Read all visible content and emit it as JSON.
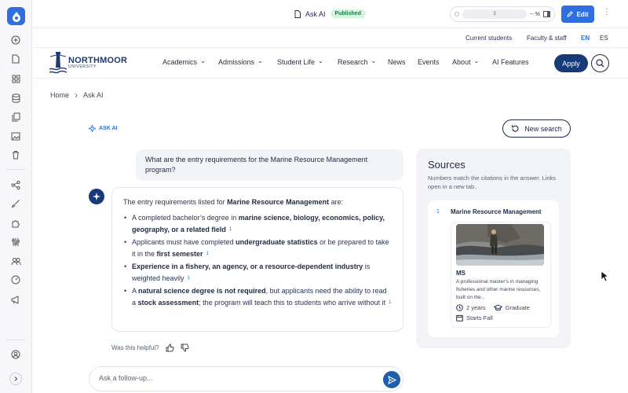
{
  "toolbar": {
    "doc_title": "Ask AI",
    "status_badge": "Published",
    "zoom_value": "3",
    "zoom_pct": "-- %",
    "edit_label": "Edit",
    "more_label": "⋮"
  },
  "utility": {
    "current_students": "Current students",
    "faculty_staff": "Faculty & staff",
    "lang_en": "EN",
    "lang_es": "ES"
  },
  "brand": {
    "name": "NORTHMOOR",
    "sub": "UNIVERSITY"
  },
  "nav": {
    "items": [
      {
        "label": "Academics",
        "dropdown": "⌄"
      },
      {
        "label": "Admissions",
        "dropdown": "⌄"
      },
      {
        "label": "Student Life",
        "dropdown": "⌄"
      },
      {
        "label": "Research",
        "dropdown": "⌄"
      },
      {
        "label": "News"
      },
      {
        "label": "Events"
      },
      {
        "label": "About",
        "dropdown": "⌄"
      },
      {
        "label": "AI Features"
      }
    ],
    "apply_label": "Apply"
  },
  "breadcrumb": {
    "home": "Home",
    "separator": "›",
    "current": "Ask AI"
  },
  "chat": {
    "ask_ai_label": "ASK AI",
    "new_search_label": "New search",
    "question": "What are the entry requirements for the Marine Resource Management program?",
    "answer": {
      "intro_prefix": "The entry requirements listed for ",
      "intro_program": "Marine Resource Management",
      "intro_suffix": " are:",
      "bullets": [
        {
          "t1": "A completed bachelor’s degree in ",
          "b1": "marine science, biology, economics, policy, geography, or a related field",
          "t2": "",
          "b2": "",
          "t3": "",
          "cite": "1"
        },
        {
          "t1": "Applicants must have completed ",
          "b1": "undergraduate statistics",
          "t2": " or be prepared to take it in the ",
          "b2": "first semester",
          "t3": "",
          "cite": "1"
        },
        {
          "t1": "",
          "b1": "Experience in a fishery, an agency, or a resource-dependent industry",
          "t2": " is weighted heavily",
          "b2": "",
          "t3": "",
          "cite": "1"
        },
        {
          "t1": "A ",
          "b1": "natural science degree is not required",
          "t2": ", but applicants need the ability to read a ",
          "b2": "stock assessment",
          "t3": "; the program will teach this to students who arrive without it",
          "cite": "1"
        }
      ]
    },
    "helpful_label": "Was this helpful?",
    "followup_placeholder": "Ask a follow-up..."
  },
  "sources": {
    "title": "Sources",
    "note": "Numbers match the citations in the answer. Links open in a new tab.",
    "items": [
      {
        "number": "1",
        "title": "Marine Resource Management",
        "degree": "MS",
        "description": "A professional master's in managing fisheries and other marine resources, built on the...",
        "duration": "2 years",
        "level": "Graduate",
        "start": "Starts Fall"
      }
    ]
  },
  "colors": {
    "accent": "#2f6fe0",
    "brand_navy": "#163b78",
    "published_bg": "#d7f5e2",
    "published_text": "#1d7a45"
  },
  "icons": {
    "rail": [
      "drupal-logo-icon",
      "add-circle-icon",
      "document-icon",
      "blocks-grid-icon",
      "database-icon",
      "copy-icon",
      "image-icon",
      "trash-icon",
      "share-nodes-icon",
      "brush-icon",
      "puzzle-icon",
      "sliders-icon",
      "users-icon",
      "gauge-icon",
      "megaphone-icon",
      "account-circle-icon",
      "expand-chevron-icon"
    ]
  }
}
